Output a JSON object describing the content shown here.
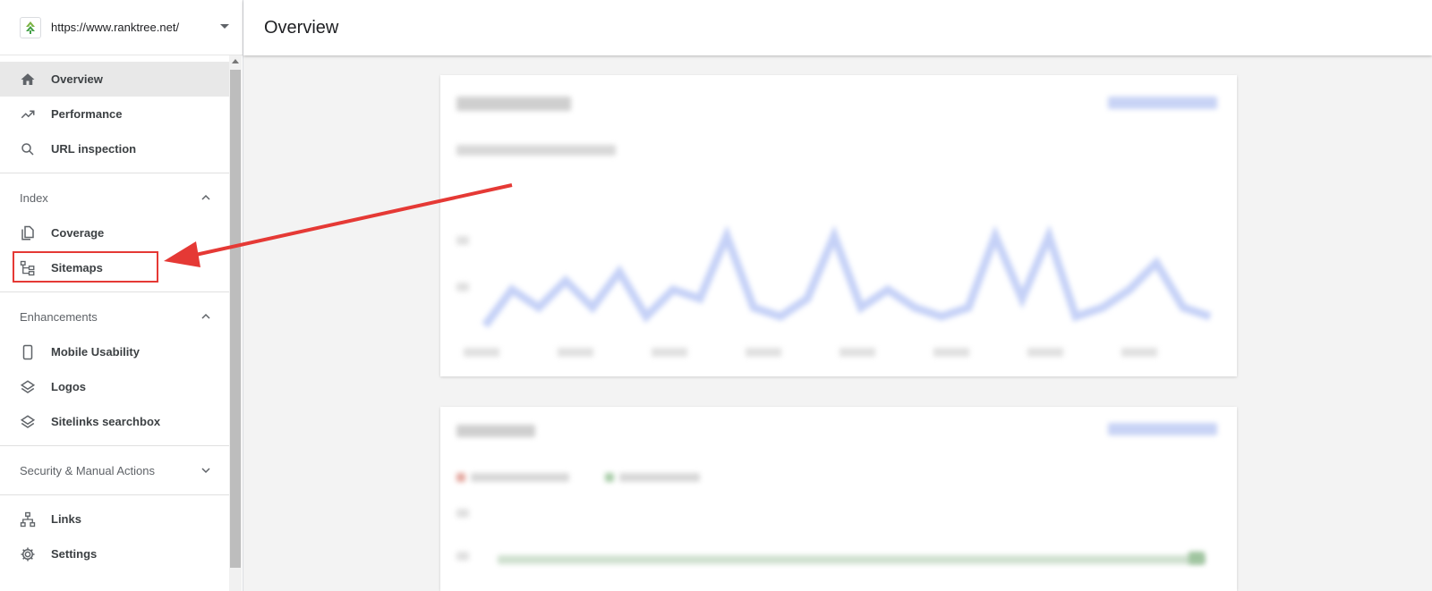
{
  "property": {
    "url": "https://www.ranktree.net/",
    "logo_icon": "ranktree-logo"
  },
  "header": {
    "title": "Overview"
  },
  "nav": {
    "overview": "Overview",
    "performance": "Performance",
    "url_inspection": "URL inspection",
    "index_section": "Index",
    "coverage": "Coverage",
    "sitemaps": "Sitemaps",
    "enhancements_section": "Enhancements",
    "mobile_usability": "Mobile Usability",
    "logos": "Logos",
    "sitelinks_searchbox": "Sitelinks searchbox",
    "security_section": "Security & Manual Actions",
    "links": "Links",
    "settings": "Settings"
  },
  "colors": {
    "accent_red": "#e53935",
    "active_bg": "#e8e8e8",
    "chart_blue": "#c5d1f7",
    "chart_green": "#cfe0cf"
  }
}
